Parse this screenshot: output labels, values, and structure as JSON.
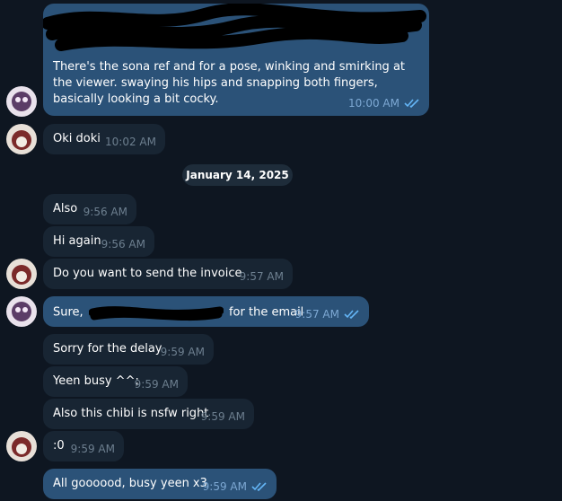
{
  "messages": [
    {
      "text": "There's the sona ref and for a pose, winking and smirking at the viewer. swaying his hips and snapping both fingers, basically looking a bit cocky.",
      "time": "10:00 AM"
    },
    {
      "text": "Oki doki",
      "time": "10:02 AM"
    },
    {
      "text": "Also",
      "time": "9:56 AM"
    },
    {
      "text": "Hi again",
      "time": "9:56 AM"
    },
    {
      "text": "Do you  want  to send the invoice",
      "time": "9:57 AM"
    },
    {
      "text_before": "Sure,",
      "text_after": "for the email",
      "time": "9:57 AM"
    },
    {
      "text": "Sorry for the delay",
      "time": "9:59 AM"
    },
    {
      "text": "Yeen busy ^^;",
      "time": "9:59 AM"
    },
    {
      "text": "Also this chibi is nsfw right",
      "time": "9:59 AM"
    },
    {
      "text": ":0",
      "time": "9:59 AM"
    },
    {
      "text": "All goooood, busy yeen x3",
      "time": "9:59 AM"
    }
  ],
  "date_separator": "January 14, 2025",
  "colors": {
    "background": "#0e1621",
    "incoming_bubble": "#182533",
    "outgoing_bubble": "#2b5278",
    "read_check": "#64b5f6"
  }
}
